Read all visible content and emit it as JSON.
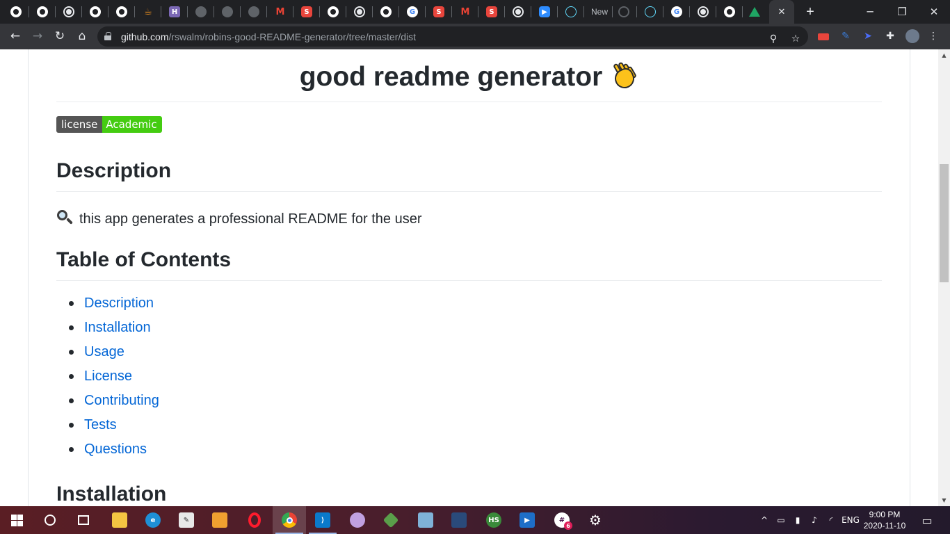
{
  "browser": {
    "tabs": [
      {
        "icon": "github-icon"
      },
      {
        "icon": "github-icon"
      },
      {
        "icon": "globe-icon"
      },
      {
        "icon": "github-icon"
      },
      {
        "icon": "github-icon"
      },
      {
        "icon": "java-icon"
      },
      {
        "icon": "heroku-icon"
      },
      {
        "icon": "globe-icon"
      },
      {
        "icon": "globe-icon"
      },
      {
        "icon": "globe-icon"
      },
      {
        "icon": "gmail-icon"
      },
      {
        "icon": "s-icon"
      },
      {
        "icon": "github-icon"
      },
      {
        "icon": "globe-icon"
      },
      {
        "icon": "github-icon"
      },
      {
        "icon": "google-icon"
      },
      {
        "icon": "s-icon"
      },
      {
        "icon": "gmail-icon"
      },
      {
        "icon": "s-icon"
      },
      {
        "icon": "globe-icon"
      },
      {
        "icon": "zoom-icon"
      },
      {
        "icon": "react-icon"
      },
      {
        "icon": "new-tab",
        "label": "New"
      },
      {
        "icon": "github-icon"
      },
      {
        "icon": "react-icon"
      },
      {
        "icon": "google-icon"
      },
      {
        "icon": "globe-icon"
      },
      {
        "icon": "github-icon"
      },
      {
        "icon": "drive-icon"
      }
    ],
    "active_tab_close": "✕",
    "new_tab_label": "+",
    "url_host": "github.com",
    "url_path": "/rswalm/robins-good-README-generator/tree/master/dist"
  },
  "readme": {
    "title": "good readme generator",
    "badge_left": "license",
    "badge_right": "Academic",
    "description_heading": "Description",
    "description_text": "this app generates a professional README for the user",
    "toc_heading": "Table of Contents",
    "toc_items": [
      "Description",
      "Installation",
      "Usage",
      "License",
      "Contributing",
      "Tests",
      "Questions"
    ],
    "installation_heading": "Installation"
  },
  "taskbar": {
    "apps": [
      "start",
      "search",
      "task-view",
      "file-explorer",
      "edge",
      "app",
      "app",
      "opera",
      "chrome",
      "vscode",
      "app",
      "app",
      "app",
      "app",
      "hubspot",
      "app",
      "slack",
      "settings"
    ],
    "language": "ENG",
    "time": "9:00 PM",
    "date": "2020-11-10",
    "slack_badge": "6"
  },
  "colors": {
    "link": "#0366d6",
    "badge_green": "#44cc11",
    "chrome_dark": "#202124"
  }
}
